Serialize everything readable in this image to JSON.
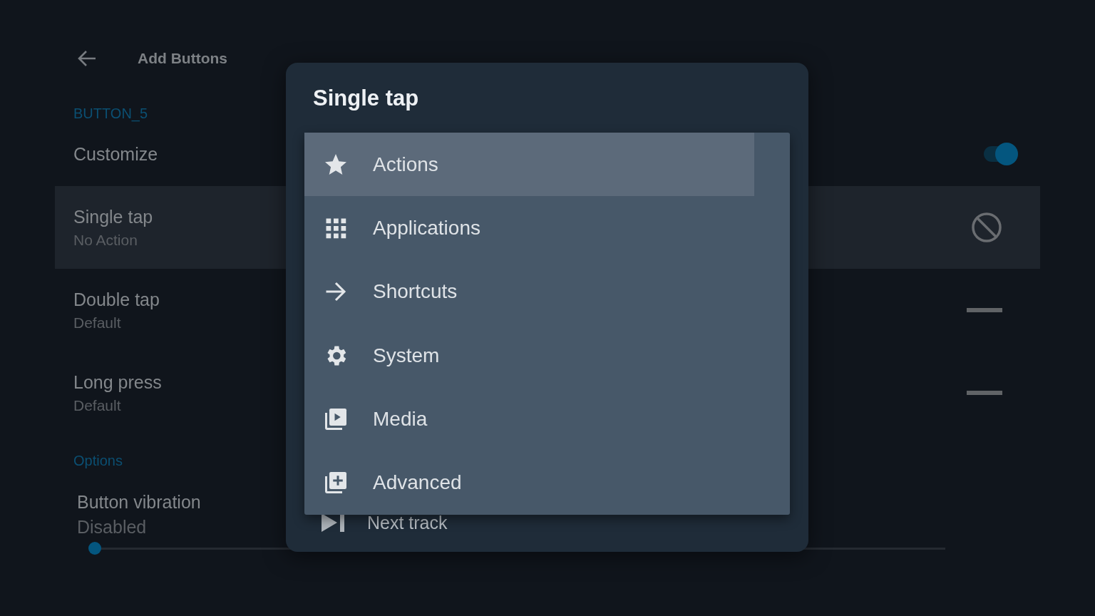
{
  "header": {
    "title": "Add Buttons"
  },
  "section": "BUTTON_5",
  "customize": {
    "label": "Customize",
    "on": true
  },
  "actions": [
    {
      "label": "Single tap",
      "value": "No Action",
      "selected": true,
      "kind": "none"
    },
    {
      "label": "Double tap",
      "value": "Default",
      "selected": false,
      "kind": "default"
    },
    {
      "label": "Long press",
      "value": "Default",
      "selected": false,
      "kind": "default"
    }
  ],
  "options_heading": "Options",
  "vibration": {
    "label": "Button vibration",
    "value": "Disabled",
    "level": 0
  },
  "dialog": {
    "title": "Single tap",
    "behind_row": {
      "label": "Next track"
    },
    "menu": [
      {
        "label": "Actions",
        "kind": "star",
        "selected": true
      },
      {
        "label": "Applications",
        "kind": "grid",
        "selected": false
      },
      {
        "label": "Shortcuts",
        "kind": "arrow",
        "selected": false
      },
      {
        "label": "System",
        "kind": "gear",
        "selected": false
      },
      {
        "label": "Media",
        "kind": "media",
        "selected": false
      },
      {
        "label": "Advanced",
        "kind": "add",
        "selected": false
      }
    ]
  }
}
